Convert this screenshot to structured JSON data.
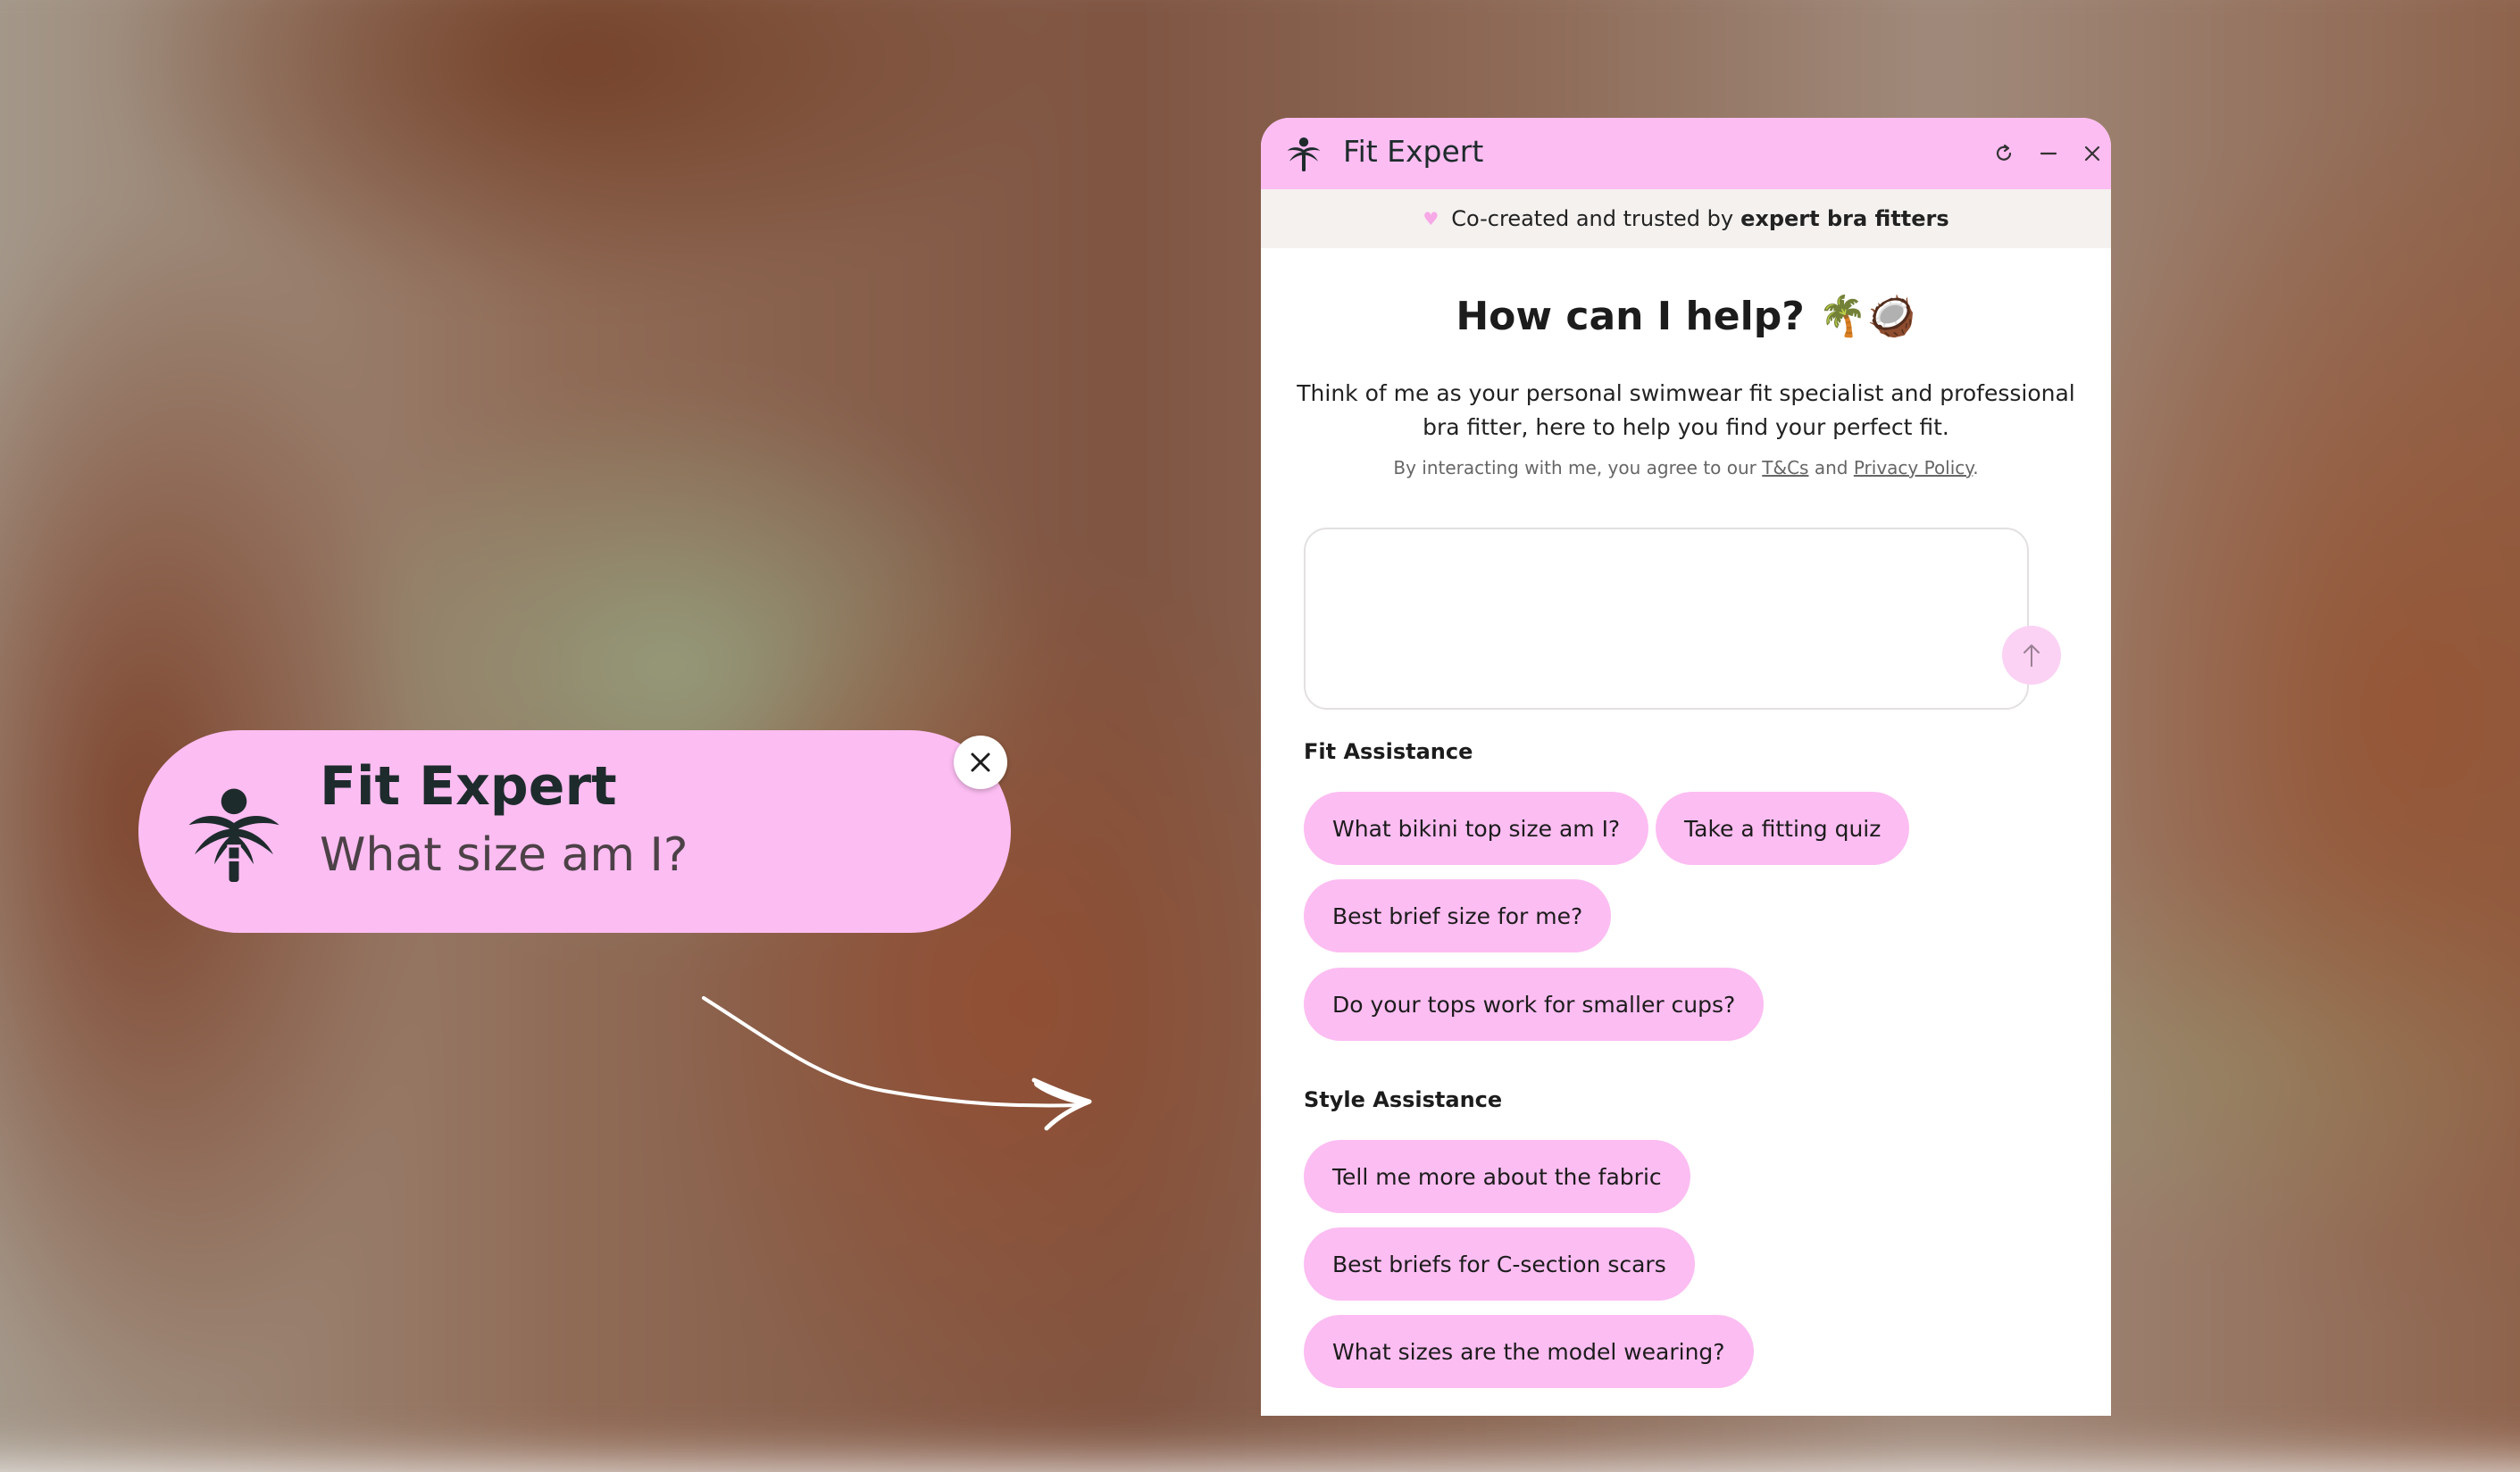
{
  "teaser": {
    "title": "Fit Expert",
    "subtitle": "What size am I?"
  },
  "panel": {
    "header_title": "Fit Expert",
    "banner_text": "Co-created and trusted by",
    "banner_bold": "expert bra fitters",
    "heading": "How can I help? 🌴🥥",
    "description": "Think of me as your personal swimwear fit specialist and professional bra fitter, here to help you find your perfect fit.",
    "legal_prefix": "By interacting with me, you agree to our",
    "legal_tcs": "T&Cs",
    "legal_and": "and",
    "legal_privacy": "Privacy Policy",
    "legal_suffix": ".",
    "input_value": "",
    "fit_section_label": "Fit Assistance",
    "fit_chips": [
      "What bikini top size am I?",
      "Take a fitting quiz",
      "Best brief size for me?",
      "Do your tops work for smaller cups?"
    ],
    "style_section_label": "Style Assistance",
    "style_chips": [
      "Tell me more about the fabric",
      "Best briefs for C-section scars",
      "What sizes are the model wearing?"
    ]
  },
  "icons": [
    "palm-tree-logo-icon",
    "refresh-icon",
    "minimize-icon",
    "close-icon",
    "heart-icon",
    "arrow-up-icon",
    "curved-arrow-icon"
  ],
  "colors": {
    "accent_pink": "#fcbdf2",
    "send_button": "#fbd2f4",
    "banner_bg": "#f4f1ef",
    "logo_dark": "#1e2b2c"
  }
}
